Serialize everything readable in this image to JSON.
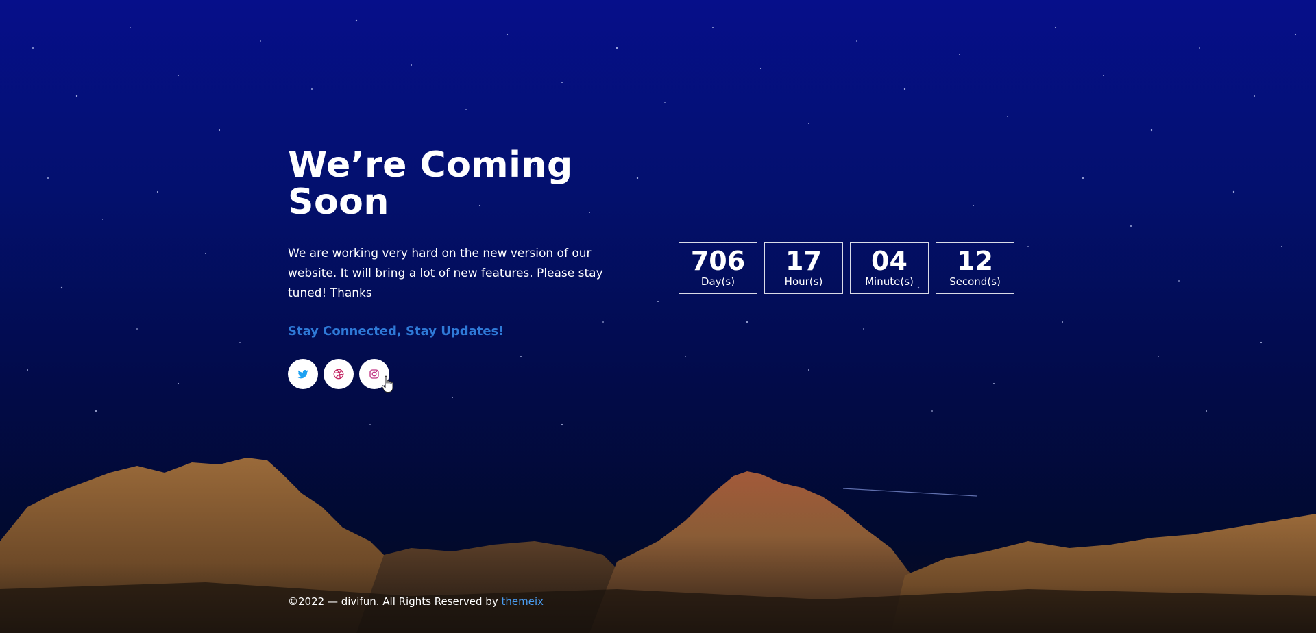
{
  "hero": {
    "title": "We’re Coming Soon",
    "description": "We are working very hard on the new version of our website. It will bring a lot of new features. Please stay tuned! Thanks",
    "tagline": "Stay Connected, Stay Updates!"
  },
  "socials": [
    {
      "icon": "twitter-icon",
      "color": "#1da1f2"
    },
    {
      "icon": "dribbble-icon",
      "color": "#c32361"
    },
    {
      "icon": "instagram-icon",
      "color": "#c13584"
    }
  ],
  "countdown": [
    {
      "value": "706",
      "label": "Day(s)"
    },
    {
      "value": "17",
      "label": "Hour(s)"
    },
    {
      "value": "04",
      "label": "Minute(s)"
    },
    {
      "value": "12",
      "label": "Second(s)"
    }
  ],
  "footer": {
    "text": "©2022 — divifun. All Rights Reserved by",
    "link": "themeix"
  },
  "colors": {
    "accent": "#2f7ad8",
    "link": "#4a9cf0",
    "background_top": "#060f8a"
  }
}
